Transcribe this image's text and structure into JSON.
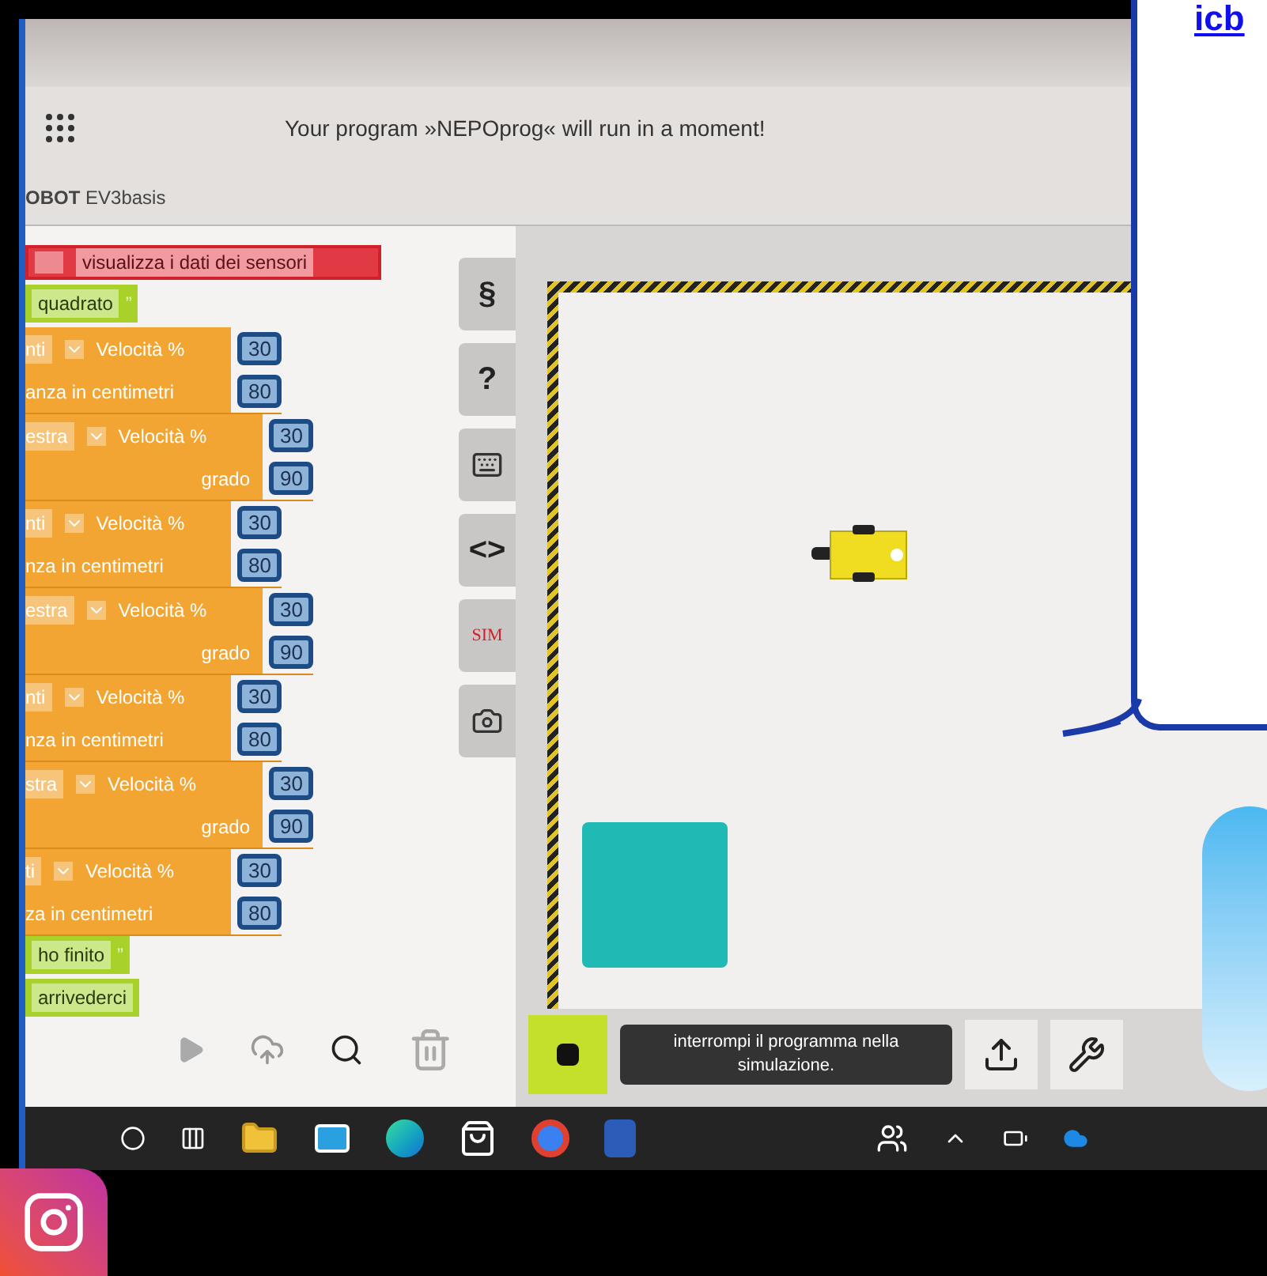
{
  "header": {
    "message": "Your program »NEPOprog« will run in a moment!",
    "robot": "**OBOT** EV3basis"
  },
  "blocks": [
    {
      "kind": "sensor",
      "text": "visualizza i dati dei sensori"
    },
    {
      "kind": "say",
      "text": "quadrato",
      "mark": "”"
    },
    {
      "kind": "straight",
      "label": "nti",
      "param": "Velocità %",
      "value": "30",
      "param2": "anza in centimetri",
      "value2": "80"
    },
    {
      "kind": "turn",
      "label": "estra",
      "param": "Velocità %",
      "value": "30",
      "param2": "grado",
      "value2": "90"
    },
    {
      "kind": "straight",
      "label": "nti",
      "param": "Velocità %",
      "value": "30",
      "param2": "nza in centimetri",
      "value2": "80"
    },
    {
      "kind": "turn",
      "label": "estra",
      "param": "Velocità %",
      "value": "30",
      "param2": "grado",
      "value2": "90"
    },
    {
      "kind": "straight",
      "label": "nti",
      "param": "Velocità %",
      "value": "30",
      "param2": "nza in centimetri",
      "value2": "80"
    },
    {
      "kind": "turn",
      "label": "stra",
      "param": "Velocità %",
      "value": "30",
      "param2": "grado",
      "value2": "90"
    },
    {
      "kind": "straight",
      "label": "ti",
      "param": "Velocità %",
      "value": "30",
      "param2": "za in centimetri",
      "value2": "80"
    },
    {
      "kind": "say",
      "text": "ho finito",
      "mark": "”"
    },
    {
      "kind": "say",
      "text": "arrivederci"
    }
  ],
  "sidebar": [
    {
      "kind": "glyph",
      "text": "§"
    },
    {
      "kind": "glyph",
      "text": "?"
    },
    {
      "kind": "keyboard"
    },
    {
      "kind": "glyph",
      "text": "<>"
    },
    {
      "kind": "sim",
      "text": "SIM"
    },
    {
      "kind": "camera"
    }
  ],
  "tooltip": "interrompi il programma nella simulazione.",
  "link": "icb"
}
